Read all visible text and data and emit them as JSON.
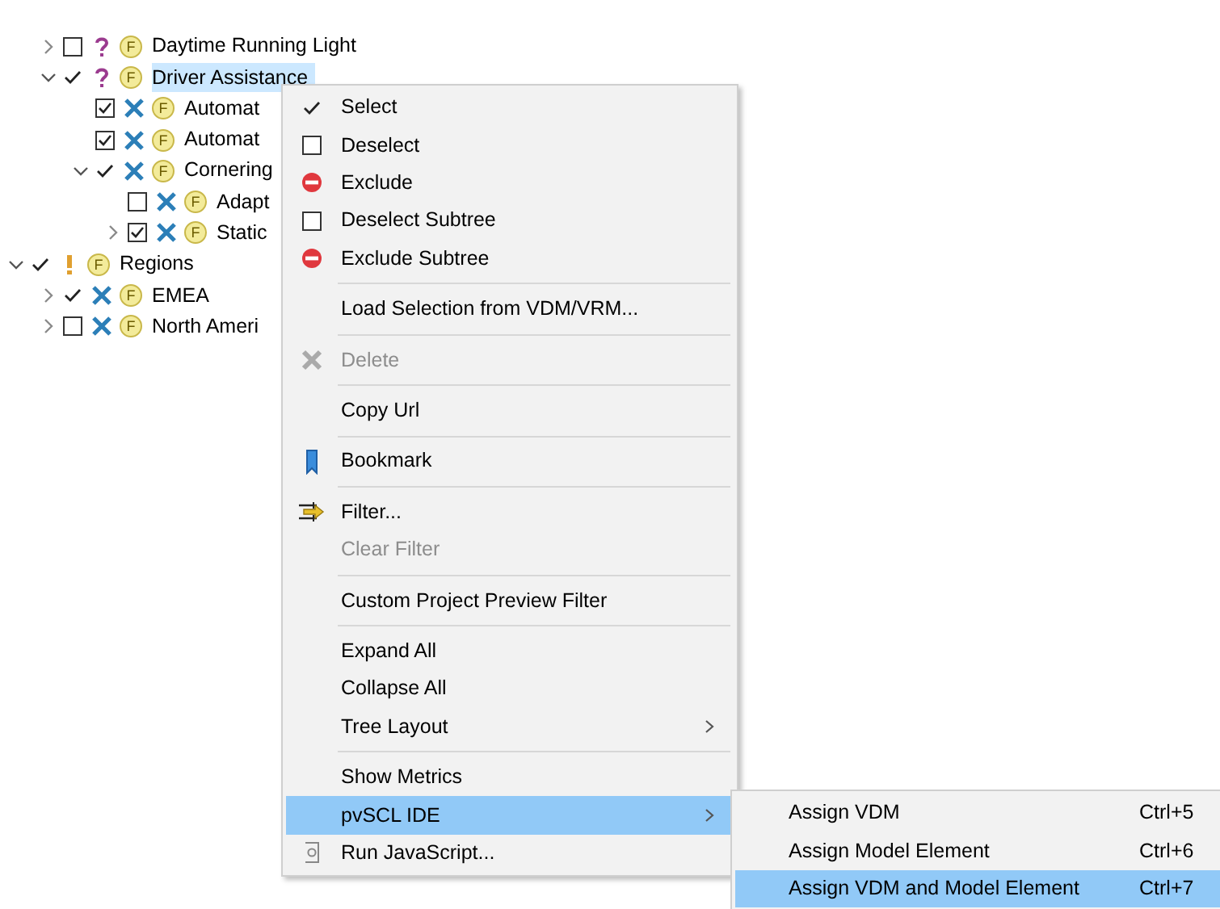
{
  "tree": {
    "partial_branch": [
      {
        "label": "Daytime Running Light",
        "checked": false,
        "implicit": false,
        "kind": "unknown",
        "badge": "F",
        "expanded": false,
        "selected": false
      },
      {
        "label": "Driver Assistance",
        "checked": true,
        "implicit": true,
        "kind": "unknown",
        "badge": "F",
        "expanded": true,
        "selected": true,
        "children": [
          {
            "label": "Automat",
            "checked": true,
            "implicit": false,
            "kind": "excluded",
            "badge": "F",
            "selected": false
          },
          {
            "label": "Automat",
            "checked": true,
            "implicit": false,
            "kind": "excluded",
            "badge": "F",
            "selected": false
          },
          {
            "label": "Cornering",
            "checked": true,
            "implicit": true,
            "kind": "excluded",
            "badge": "F",
            "expanded": true,
            "selected": false,
            "children": [
              {
                "label": "Adapt",
                "checked": false,
                "implicit": false,
                "kind": "excluded",
                "badge": "F",
                "selected": false
              },
              {
                "label": "Static",
                "checked": true,
                "implicit": false,
                "kind": "excluded",
                "badge": "F",
                "expanded": false,
                "selected": false
              }
            ]
          }
        ]
      }
    ],
    "roots": [
      {
        "label": "Regions",
        "checked": true,
        "implicit": true,
        "kind": "warning",
        "badge": "F",
        "expanded": true,
        "selected": false,
        "children": [
          {
            "label": "EMEA",
            "checked": true,
            "implicit": true,
            "kind": "excluded",
            "badge": "F",
            "expanded": false,
            "selected": false
          },
          {
            "label": "North Ameri",
            "checked": false,
            "implicit": false,
            "kind": "excluded",
            "badge": "F",
            "expanded": false,
            "selected": false
          }
        ]
      }
    ]
  },
  "context_menu": [
    {
      "kind": "select",
      "label": "Select",
      "disabled": false,
      "submenu": false,
      "selected": false
    },
    {
      "kind": "deselect",
      "label": "Deselect",
      "disabled": false,
      "submenu": false,
      "selected": false
    },
    {
      "kind": "exclude",
      "label": "Exclude",
      "disabled": false,
      "submenu": false,
      "selected": false
    },
    {
      "kind": "deselect",
      "label": "Deselect Subtree",
      "disabled": false,
      "submenu": false,
      "selected": false
    },
    {
      "kind": "exclude",
      "label": "Exclude Subtree",
      "disabled": false,
      "submenu": false,
      "selected": false
    },
    {
      "kind": "separator"
    },
    {
      "kind": "plain",
      "label": "Load Selection from VDM/VRM...",
      "disabled": false,
      "submenu": false,
      "selected": false
    },
    {
      "kind": "separator"
    },
    {
      "kind": "delete",
      "label": "Delete",
      "disabled": true,
      "submenu": false,
      "selected": false
    },
    {
      "kind": "separator"
    },
    {
      "kind": "plain",
      "label": "Copy Url",
      "disabled": false,
      "submenu": false,
      "selected": false
    },
    {
      "kind": "separator"
    },
    {
      "kind": "bookmark",
      "label": "Bookmark",
      "disabled": false,
      "submenu": false,
      "selected": false
    },
    {
      "kind": "separator"
    },
    {
      "kind": "filter",
      "label": "Filter...",
      "disabled": false,
      "submenu": false,
      "selected": false
    },
    {
      "kind": "plain",
      "label": "Clear Filter",
      "disabled": true,
      "submenu": false,
      "selected": false
    },
    {
      "kind": "separator"
    },
    {
      "kind": "plain",
      "label": "Custom Project Preview Filter",
      "disabled": false,
      "submenu": false,
      "selected": false
    },
    {
      "kind": "separator"
    },
    {
      "kind": "plain",
      "label": "Expand All",
      "disabled": false,
      "submenu": false,
      "selected": false
    },
    {
      "kind": "plain",
      "label": "Collapse All",
      "disabled": false,
      "submenu": false,
      "selected": false
    },
    {
      "kind": "plain",
      "label": "Tree Layout",
      "disabled": false,
      "submenu": true,
      "selected": false
    },
    {
      "kind": "separator"
    },
    {
      "kind": "plain",
      "label": "Show Metrics",
      "disabled": false,
      "submenu": false,
      "selected": false
    },
    {
      "kind": "plain",
      "label": "pvSCL IDE",
      "disabled": false,
      "submenu": true,
      "selected": true
    },
    {
      "kind": "script",
      "label": "Run JavaScript...",
      "disabled": false,
      "submenu": false,
      "selected": false
    }
  ],
  "submenu": [
    {
      "label": "Assign VDM",
      "shortcut": "Ctrl+5",
      "selected": false
    },
    {
      "label": "Assign Model Element",
      "shortcut": "Ctrl+6",
      "selected": false
    },
    {
      "label": "Assign VDM and Model Element",
      "shortcut": "Ctrl+7",
      "selected": true
    }
  ]
}
